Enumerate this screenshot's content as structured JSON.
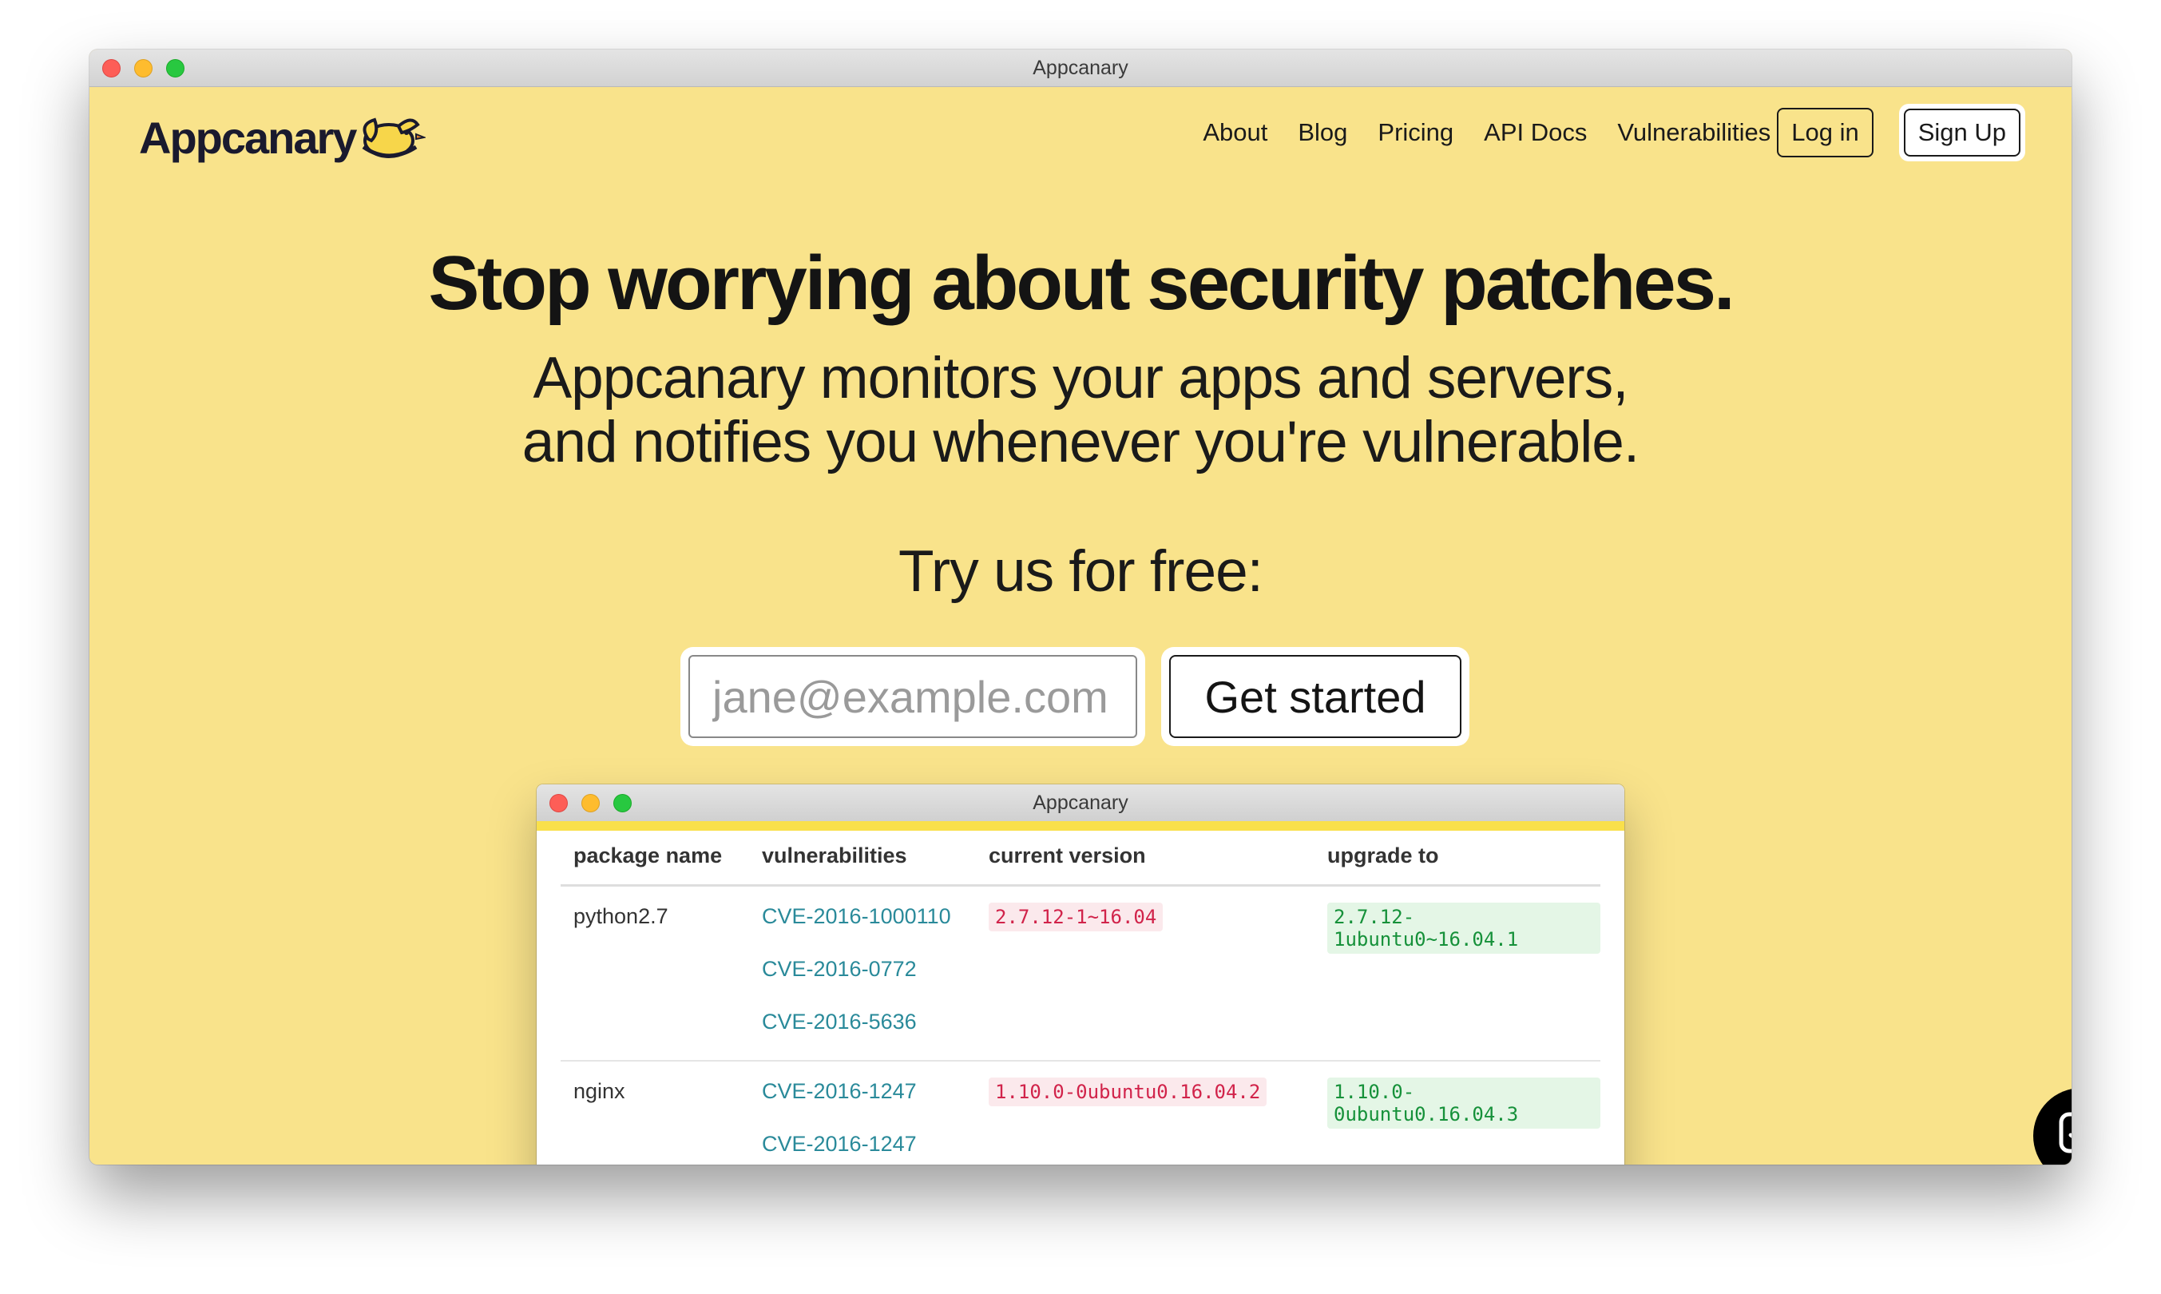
{
  "window": {
    "title": "Appcanary"
  },
  "header": {
    "logo_text": "Appcanary",
    "nav": [
      {
        "label": "About"
      },
      {
        "label": "Blog"
      },
      {
        "label": "Pricing"
      },
      {
        "label": "API Docs"
      },
      {
        "label": "Vulnerabilities"
      }
    ],
    "login_label": "Log in",
    "signup_label": "Sign Up"
  },
  "hero": {
    "headline": "Stop worrying about security patches.",
    "subhead_line1": "Appcanary monitors your apps and servers,",
    "subhead_line2": "and notifies you whenever you're vulnerable.",
    "cta_text": "Try us for free:",
    "email_placeholder": "jane@example.com",
    "button_label": "Get started"
  },
  "demo_window": {
    "title": "Appcanary",
    "columns": [
      "package name",
      "vulnerabilities",
      "current version",
      "upgrade to"
    ],
    "rows": [
      {
        "package": "python2.7",
        "cves": [
          "CVE-2016-1000110",
          "CVE-2016-0772",
          "CVE-2016-5636"
        ],
        "current": "2.7.12-1~16.04",
        "upgrade": "2.7.12-1ubuntu0~16.04.1"
      },
      {
        "package": "nginx",
        "cves": [
          "CVE-2016-1247",
          "CVE-2016-1247"
        ],
        "current": "1.10.0-0ubuntu0.16.04.2",
        "upgrade": "1.10.0-0ubuntu0.16.04.3"
      }
    ]
  },
  "colors": {
    "page_background": "#f9e38b",
    "accent_bar": "#f9e04b",
    "cve_link": "#2a8a9a",
    "current_version": "#d1234a",
    "upgrade_version": "#16913a"
  },
  "icons": {
    "logo_mark": "canary-bird-icon",
    "chat": "chat-bubble-icon"
  }
}
